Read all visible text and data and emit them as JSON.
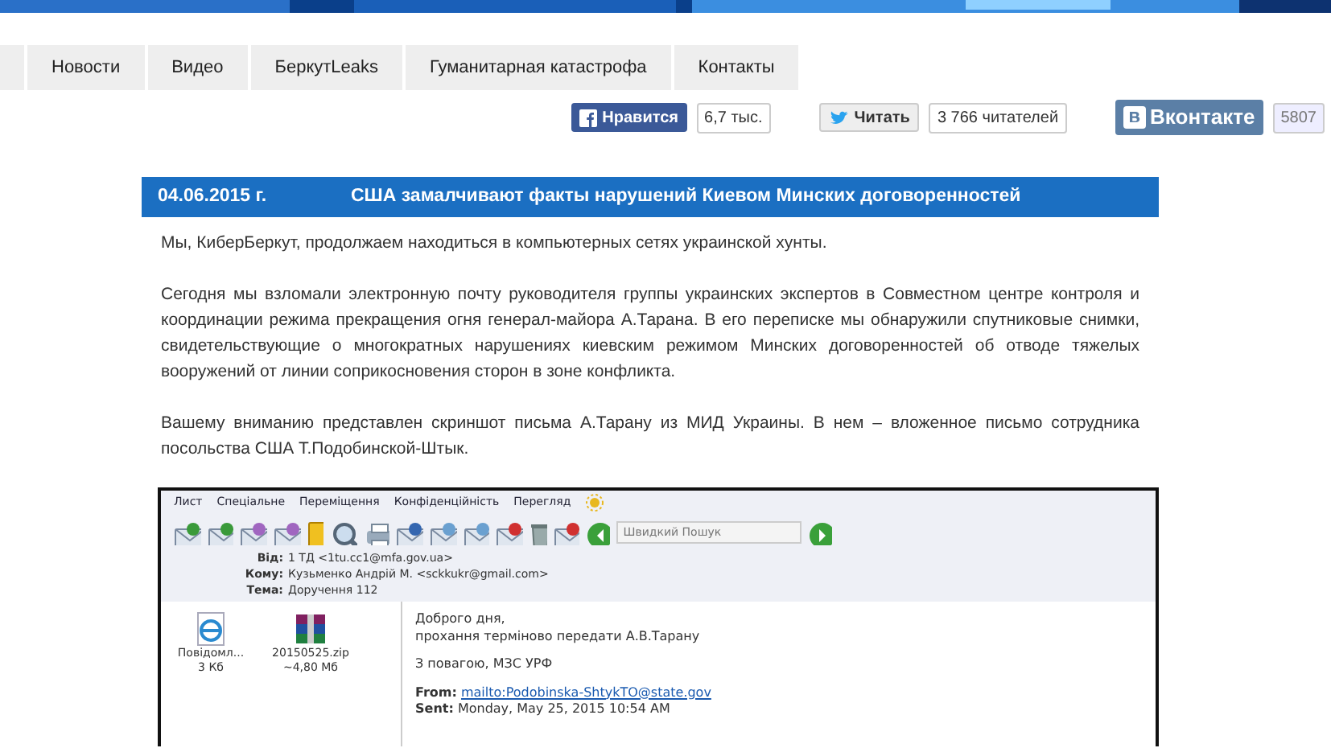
{
  "nav": [
    {
      "label": "Новости"
    },
    {
      "label": "Видео"
    },
    {
      "label": "БеркутLeaks"
    },
    {
      "label": "Гуманитарная катастрофа"
    },
    {
      "label": "Контакты"
    }
  ],
  "social": [
    {
      "kind": "facebook",
      "label": "Нравится",
      "count": "6,7 тыс."
    },
    {
      "kind": "twitter",
      "label": "Читать",
      "count": "3 766 читателей"
    },
    {
      "kind": "vk",
      "label": "Вконтакте",
      "count": "5807"
    }
  ],
  "article": {
    "date": "04.06.2015 г.",
    "title": "США замалчивают факты нарушений Киевом Минских договоренностей",
    "paragraphs": [
      "Мы, КиберБеркут, продолжаем находиться в компьютерных сетях украинской хунты.",
      "Сегодня мы взломали электронную почту руководителя группы украинских экспертов в Совместном центре контроля и координации режима прекращения огня генерал-майора А.Тарана. В его переписке мы обнаружили спутниковые снимки, свидетельствующие о многократных нарушениях киевским режимом Минских договоренностей об отводе тяжелых вооружений от линии соприкосновения сторон в зоне конфликта.",
      "Вашему вниманию представлен скриншот письма А.Тарану из МИД Украины. В нем – вложенное письмо сотрудника посольства США Т.Подобинской-Штык."
    ]
  },
  "mail": {
    "menu": [
      "Лист",
      "Спеціальне",
      "Переміщення",
      "Конфіденційність",
      "Перегляд"
    ],
    "search_placeholder": "Швидкий Пошук",
    "headers": [
      {
        "label": "Від:",
        "value": "1 ТД <1tu.cc1@mfa.gov.ua>"
      },
      {
        "label": "Кому:",
        "value": "Кузьменко Андрій М. <sckkukr@gmail.com>"
      },
      {
        "label": "Тема:",
        "value": "Доручення 112"
      }
    ],
    "attachments": [
      {
        "kind": "html",
        "name": "Повідомл...",
        "size": "3 Кб"
      },
      {
        "kind": "zip",
        "name": "20150525.zip",
        "size": "~4,80 Мб"
      }
    ],
    "body": [
      "Доброго дня,",
      "прохання терміново передати А.В.Тарану",
      "З повагою, МЗС УРФ"
    ],
    "fields": [
      {
        "label": "From:",
        "value": "mailto:Podobinska-ShtykTO@state.gov",
        "kind": "link"
      },
      {
        "label": "Sent:",
        "value": "Monday, May 25, 2015 10:54 AM",
        "kind": "text"
      }
    ]
  }
}
